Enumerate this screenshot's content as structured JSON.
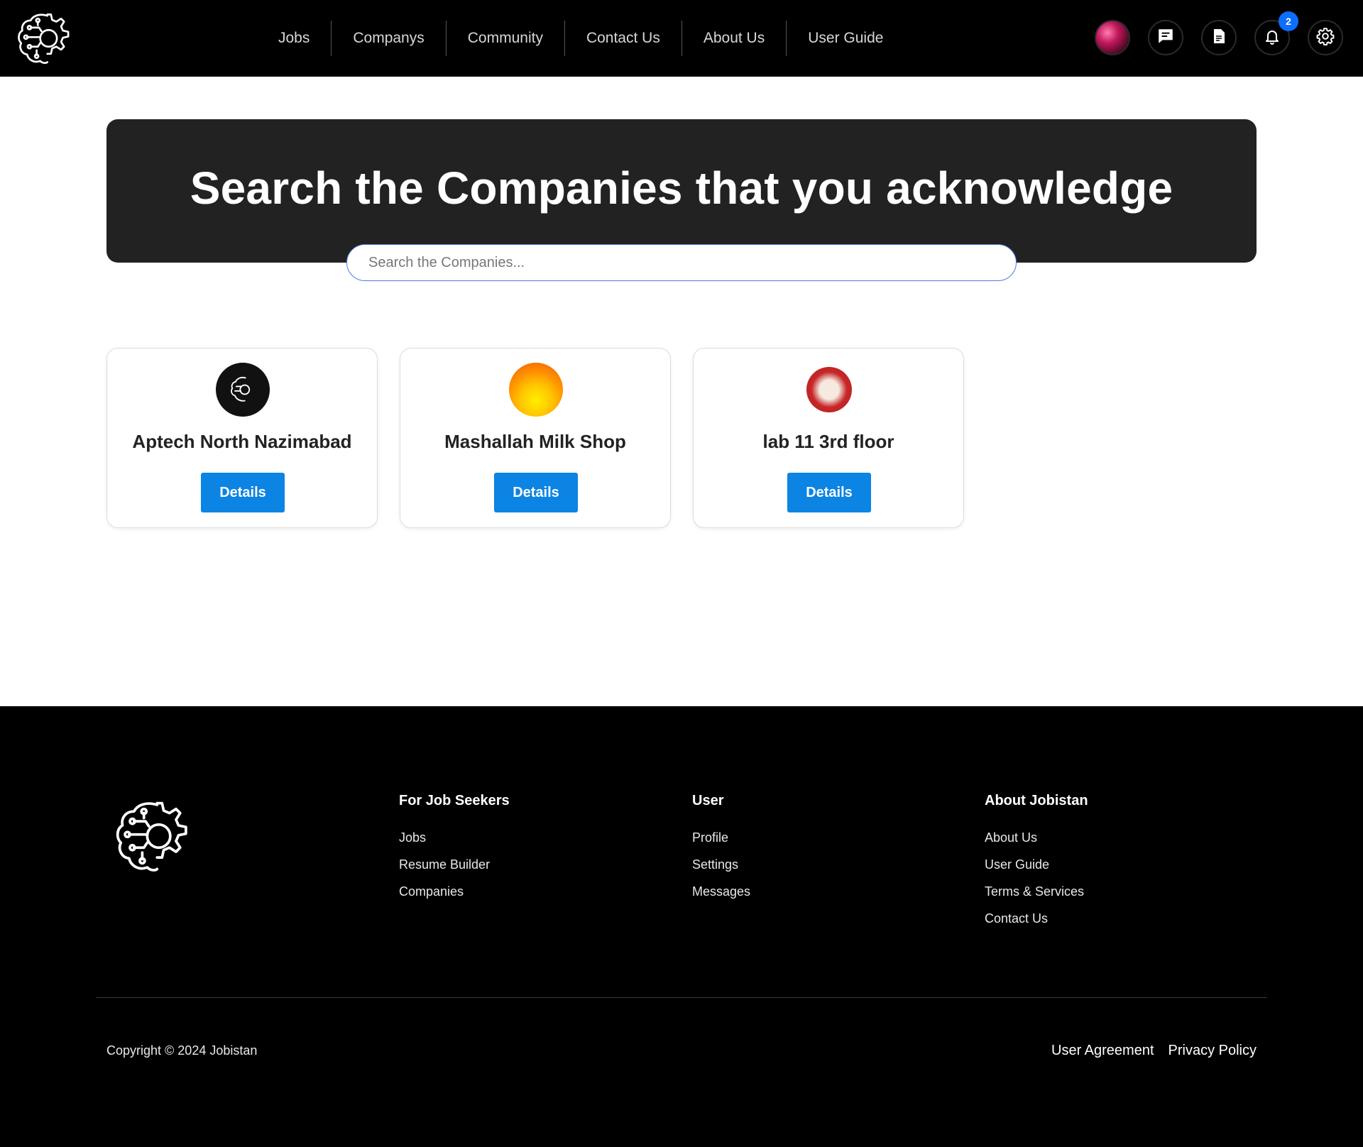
{
  "nav": {
    "links": [
      "Jobs",
      "Companys",
      "Community",
      "Contact Us",
      "About Us",
      "User Guide"
    ],
    "notification_count": "2",
    "icons": [
      "avatar",
      "chat-icon",
      "document-icon",
      "bell-icon",
      "gear-icon"
    ]
  },
  "hero": {
    "title": "Search the Companies that you acknowledge",
    "search_placeholder": "Search the Companies..."
  },
  "companies": [
    {
      "name": "Aptech North Nazimabad",
      "button": "Details"
    },
    {
      "name": "Mashallah Milk Shop",
      "button": "Details"
    },
    {
      "name": "lab 11 3rd floor",
      "button": "Details"
    }
  ],
  "footer": {
    "columns": [
      {
        "title": "For Job Seekers",
        "links": [
          "Jobs",
          "Resume Builder",
          "Companies"
        ]
      },
      {
        "title": "User",
        "links": [
          "Profile",
          "Settings",
          "Messages"
        ]
      },
      {
        "title": "About Jobistan",
        "links": [
          "About Us",
          "User Guide",
          "Terms & Services",
          "Contact Us"
        ]
      }
    ],
    "copyright": "Copyright © 2024 Jobistan",
    "legal": [
      "User Agreement",
      "Privacy Policy"
    ]
  },
  "colors": {
    "nav_bg": "#000000",
    "hero_bg": "#222222",
    "button": "#0b84e3",
    "badge": "#0d6efd"
  }
}
